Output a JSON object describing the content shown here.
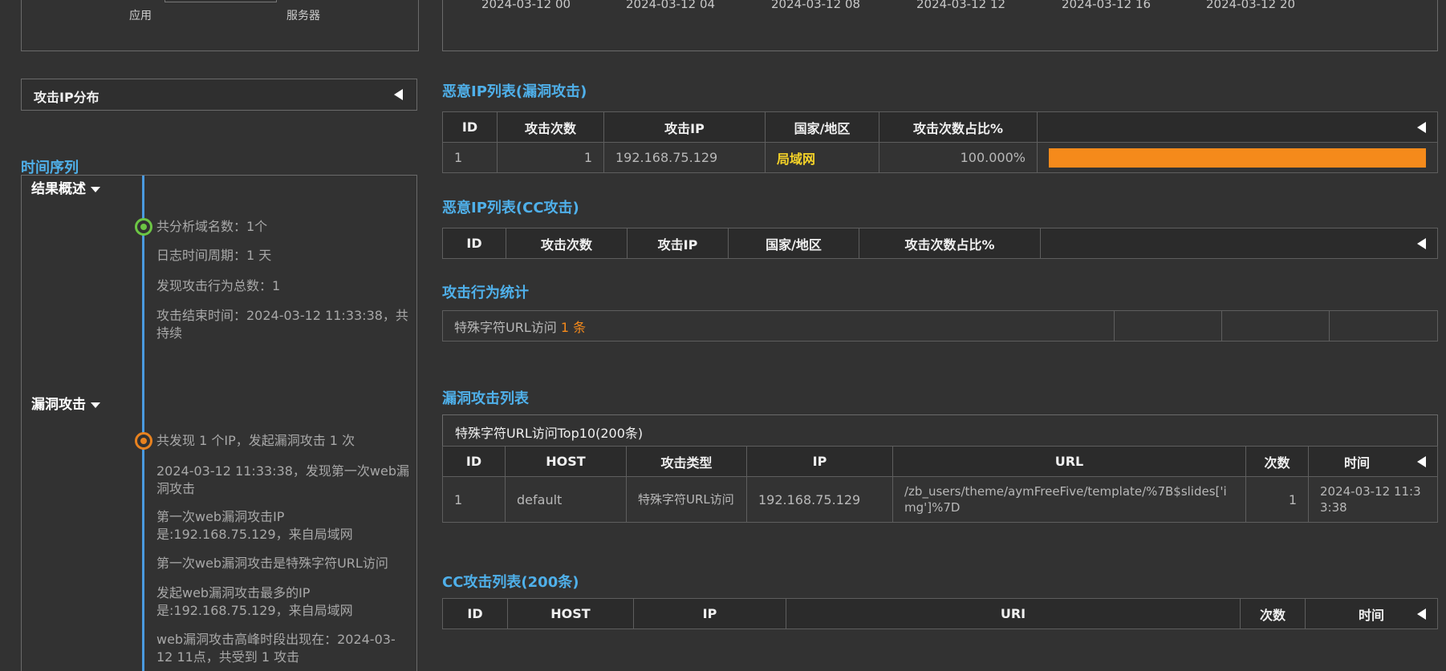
{
  "top_left_panel": {
    "labels": [
      "应用",
      "服务器"
    ]
  },
  "top_chart": {
    "x_ticks": [
      "2024-03-12 00",
      "2024-03-12 04",
      "2024-03-12 08",
      "2024-03-12 12",
      "2024-03-12 16",
      "2024-03-12 20"
    ]
  },
  "ip_distribution": {
    "title": "攻击IP分布"
  },
  "timeline": {
    "title": "时间序列",
    "summary": {
      "heading": "结果概述",
      "items": [
        "共分析域名数：1个",
        "日志时间周期：1 天",
        "发现攻击行为总数：1",
        "攻击结束时间：2024-03-12 11:33:38，共持续"
      ],
      "dot_color": "#6cc644"
    },
    "vuln": {
      "heading": "漏洞攻击",
      "items": [
        "共发现 1 个IP，发起漏洞攻击 1 次",
        "2024-03-12 11:33:38，发现第一次web漏洞攻击",
        "第一次web漏洞攻击IP是:192.168.75.129，来自局域网",
        "第一次web漏洞攻击是特殊字符URL访问",
        "发起web漏洞攻击最多的IP是:192.168.75.129，来自局域网",
        "web漏洞攻击高峰时段出现在：2024-03-12 11点，共受到 1 攻击"
      ],
      "dot_color": "#e8821f"
    }
  },
  "malicious_vuln": {
    "title": "恶意IP列表(漏洞攻击)",
    "headers": [
      "ID",
      "攻击次数",
      "攻击IP",
      "国家/地区",
      "攻击次数占比%"
    ],
    "rows": [
      {
        "id": "1",
        "count": "1",
        "ip": "192.168.75.129",
        "region": "局域网",
        "ratio": "100.000%",
        "ratio_fraction": 1.0
      }
    ],
    "bar_color": "#f58a1b",
    "region_color": "#f5d328"
  },
  "malicious_cc": {
    "title": "恶意IP列表(CC攻击)",
    "headers": [
      "ID",
      "攻击次数",
      "攻击IP",
      "国家/地区",
      "攻击次数占比%"
    ]
  },
  "behavior_stats": {
    "title": "攻击行为统计",
    "label": "特殊字符URL访问",
    "count": "1 条"
  },
  "vuln_list": {
    "title": "漏洞攻击列表",
    "subtitle": "特殊字符URL访问Top10(200条)",
    "headers": [
      "ID",
      "HOST",
      "攻击类型",
      "IP",
      "URL",
      "次数",
      "时间"
    ],
    "rows": [
      {
        "id": "1",
        "host": "default",
        "type": "特殊字符URL访问",
        "ip": "192.168.75.129",
        "url": "/zb_users/theme/aymFreeFive/template/%7B$slides['img']%7D",
        "count": "1",
        "time": "2024-03-12 11:33:38"
      }
    ]
  },
  "cc_list": {
    "title": "CC攻击列表(200条)",
    "headers": [
      "ID",
      "HOST",
      "IP",
      "URI",
      "次数",
      "时间"
    ]
  }
}
